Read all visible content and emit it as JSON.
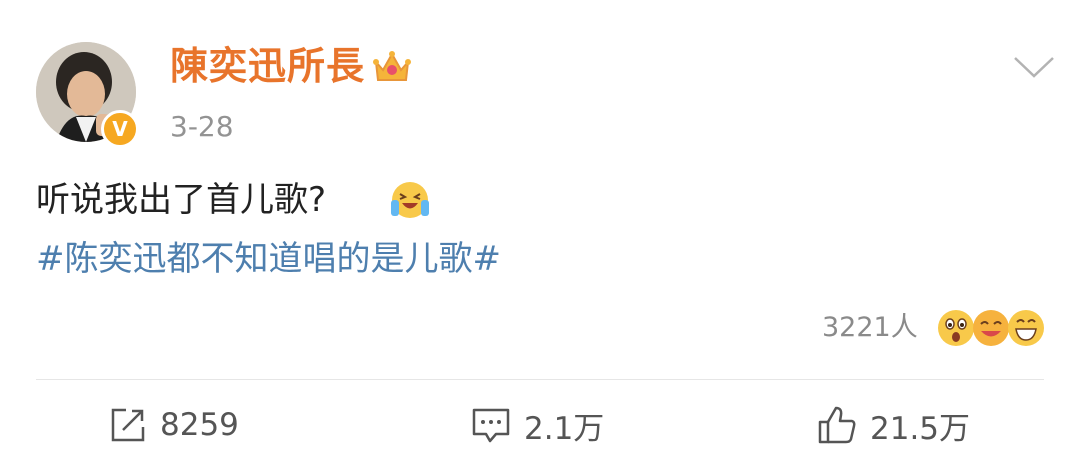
{
  "post": {
    "author": {
      "name": "陳奕迅所長",
      "verified_badge": "V",
      "avatar_icon": "avatar",
      "badge_icon": "crown-icon"
    },
    "timestamp": "3-28",
    "text": "听说我出了首儿歌?",
    "text_emoji": "laugh-cry-emoji",
    "hashtag": "#陈奕迅都不知道唱的是儿歌#",
    "reactions": {
      "count_label": "3221人",
      "emojis": [
        "surprised-emoji",
        "laugh-emoji",
        "grin-emoji"
      ]
    }
  },
  "actions": {
    "share": {
      "icon": "share-icon",
      "count": "8259"
    },
    "comment": {
      "icon": "comment-icon",
      "count": "2.1万"
    },
    "like": {
      "icon": "thumbs-up-icon",
      "count": "21.5万"
    }
  },
  "colors": {
    "username": "#e8742b",
    "hashtag": "#4e7fae",
    "verified": "#f6a821",
    "muted": "#939393"
  }
}
